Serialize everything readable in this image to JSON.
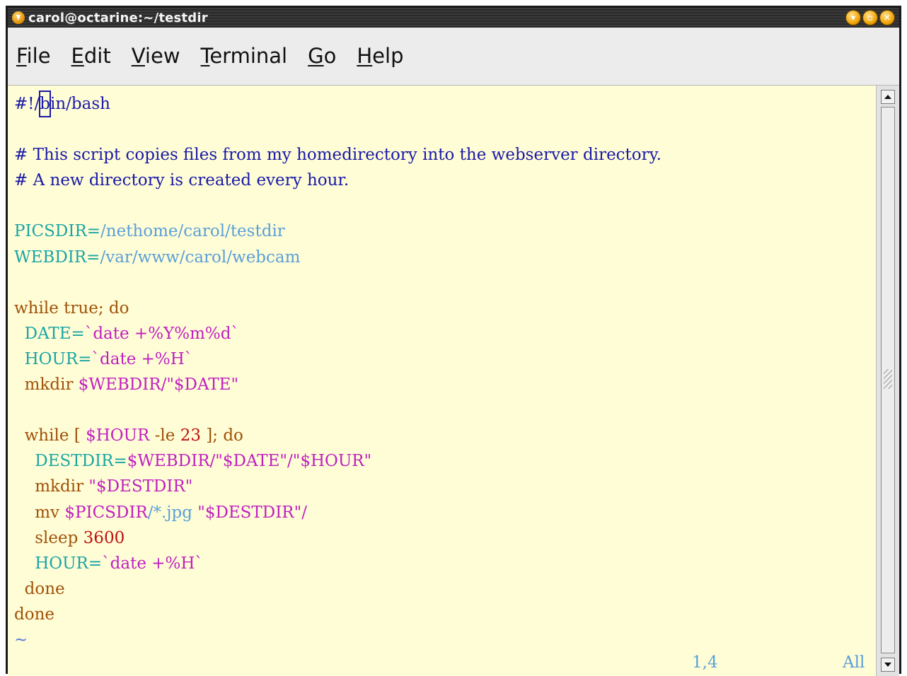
{
  "window": {
    "title": "carol@octarine:~/testdir",
    "buttons": [
      "minimize",
      "maximize",
      "close"
    ]
  },
  "menubar": {
    "items": [
      {
        "mnemonic": "F",
        "rest": "ile"
      },
      {
        "mnemonic": "E",
        "rest": "dit"
      },
      {
        "mnemonic": "V",
        "rest": "iew"
      },
      {
        "mnemonic": "T",
        "rest": "erminal"
      },
      {
        "mnemonic": "G",
        "rest": "o"
      },
      {
        "mnemonic": "H",
        "rest": "elp"
      }
    ]
  },
  "editor": {
    "lines": [
      "#!/bin/bash",
      "",
      "# This script copies files from my homedirectory into the webserver directory.",
      "# A new directory is created every hour.",
      "",
      "PICSDIR=/nethome/carol/testdir",
      "WEBDIR=/var/www/carol/webcam",
      "",
      "while true; do",
      "  DATE=`date +%Y%m%d`",
      "  HOUR=`date +%H`",
      "  mkdir $WEBDIR/\"$DATE\"",
      "",
      "  while [ $HOUR -le 23 ]; do",
      "    DESTDIR=$WEBDIR/\"$DATE\"/\"$HOUR\"",
      "    mkdir \"$DESTDIR\"",
      "    mv $PICSDIR/*.jpg \"$DESTDIR\"/",
      "    sleep 3600",
      "    HOUR=`date +%H`",
      "  done",
      "done",
      "~"
    ],
    "status_position": "1,4",
    "status_scroll": "All",
    "colors": {
      "background": "#fffdd6",
      "comment": "#1a1aa8",
      "variable": "#1aa5a5",
      "path": "#5aa0d8",
      "keyword": "#a0520a",
      "string": "#c020c0",
      "number": "#c01010"
    }
  },
  "icons": {
    "title_icon": "app-icon",
    "scroll_up": "arrow-up-icon",
    "scroll_down": "arrow-down-icon"
  }
}
